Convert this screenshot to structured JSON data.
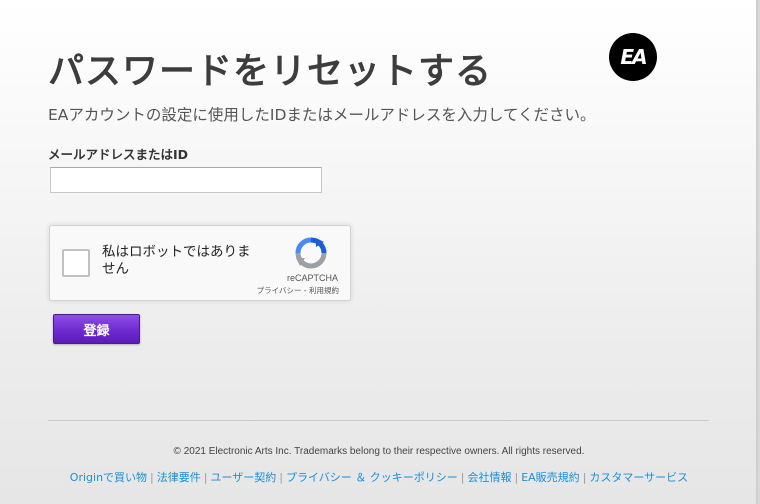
{
  "page": {
    "title": "パスワードをリセットする",
    "logo_text": "EA",
    "subtitle": "EAアカウントの設定に使用したIDまたはメールアドレスを入力してください。"
  },
  "form": {
    "email_label": "メールアドレスまたはID",
    "email_value": "",
    "email_placeholder": "",
    "submit_label": "登録"
  },
  "captcha": {
    "text": "私はロボットではありません",
    "brand": "reCAPTCHA",
    "privacy_label": "プライバシー",
    "separator": " - ",
    "terms_label": "利用規約",
    "icon": "recaptcha-logo-icon"
  },
  "footer": {
    "copyright": "© 2021 Electronic Arts Inc. Trademarks belong to their respective owners. All rights reserved.",
    "links": [
      "Originで買い物",
      "法律要件",
      "ユーザー契約",
      "プライバシー ＆ クッキーポリシー",
      "会社情報",
      "EA販売規約",
      "カスタマーサービス"
    ]
  },
  "colors": {
    "button": "#6e2ad0",
    "link": "#1a8fd6",
    "title": "#3d3d3d"
  }
}
